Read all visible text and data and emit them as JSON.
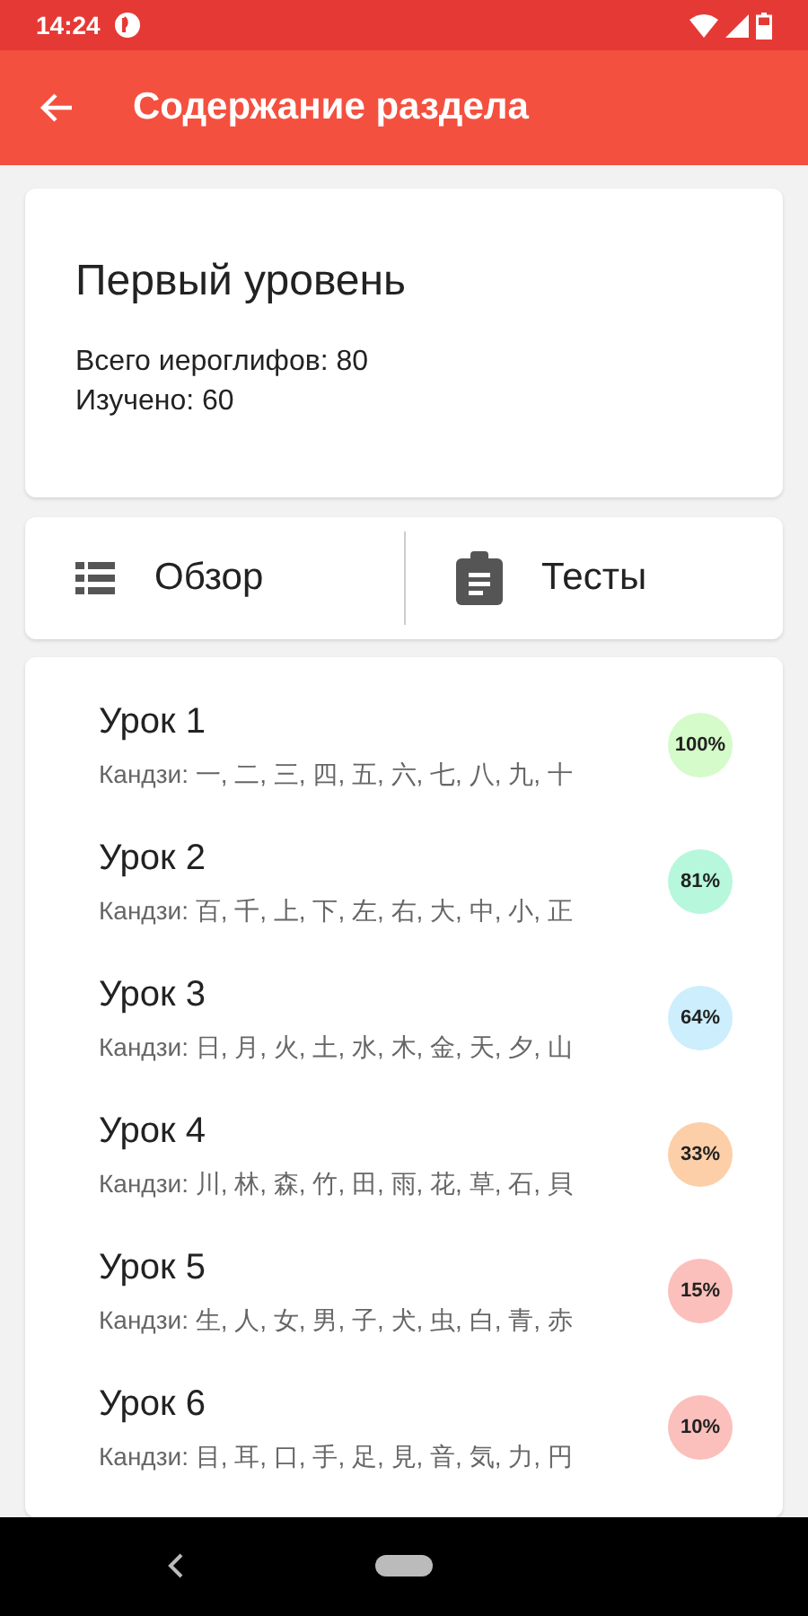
{
  "status_bar": {
    "time": "14:24"
  },
  "app_bar": {
    "title": "Содержание раздела"
  },
  "summary": {
    "title": "Первый уровень",
    "total_label": "Всего иероглифов:  80",
    "learned_label": "Изучено: 60"
  },
  "modes": [
    {
      "label": "Обзор",
      "kind": "list"
    },
    {
      "label": "Тесты",
      "kind": "clipboard"
    }
  ],
  "lessons": [
    {
      "title": "Урок 1",
      "kanji": "Кандзи: 一, 二, 三, 四, 五, 六, 七, 八, 九, 十",
      "progress": "100%",
      "color": "#d4fbc9"
    },
    {
      "title": "Урок 2",
      "kanji": "Кандзи: 百, 千, 上, 下, 左, 右, 大, 中, 小, 正",
      "progress": "81%",
      "color": "#b7f7dc"
    },
    {
      "title": "Урок 3",
      "kanji": "Кандзи: 日, 月, 火, 土, 水, 木, 金, 天, 夕, 山",
      "progress": "64%",
      "color": "#cdeefc"
    },
    {
      "title": "Урок 4",
      "kanji": "Кандзи: 川, 林, 森, 竹, 田, 雨, 花, 草, 石, 貝",
      "progress": "33%",
      "color": "#fdcfa8"
    },
    {
      "title": "Урок 5",
      "kanji": "Кандзи: 生, 人, 女, 男, 子, 犬, 虫, 白, 青, 赤",
      "progress": "15%",
      "color": "#fbc0bb"
    },
    {
      "title": "Урок 6",
      "kanji": "Кандзи: 目, 耳, 口, 手, 足, 見, 音, 気, 力, 円",
      "progress": "10%",
      "color": "#fbc0bb"
    }
  ]
}
